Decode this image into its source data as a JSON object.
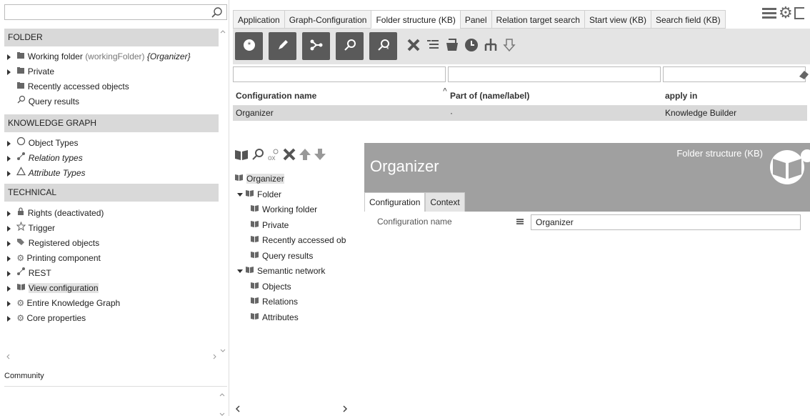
{
  "search": {
    "value": ""
  },
  "sections": {
    "folder": "FOLDER",
    "knowledge_graph": "KNOWLEDGE GRAPH",
    "technical": "TECHNICAL"
  },
  "folder_items": [
    {
      "label": "Working folder",
      "note": "(workingFolder)",
      "extra": "{Organizer}"
    },
    {
      "label": "Private"
    },
    {
      "label": "Recently accessed objects"
    },
    {
      "label": "Query results"
    }
  ],
  "kg_items": [
    {
      "label": "Object Types"
    },
    {
      "label": "Relation types"
    },
    {
      "label": "Attribute Types"
    }
  ],
  "tech_items": [
    {
      "label": "Rights (deactivated)"
    },
    {
      "label": "Trigger"
    },
    {
      "label": "Registered objects"
    },
    {
      "label": "Printing component"
    },
    {
      "label": "REST"
    },
    {
      "label": "View configuration"
    },
    {
      "label": "Entire Knowledge Graph"
    },
    {
      "label": "Core properties"
    }
  ],
  "community": {
    "label": "Community"
  },
  "tabs": [
    "Application",
    "Graph-Configuration",
    "Folder structure (KB)",
    "Panel",
    "Relation target search",
    "Start view (KB)",
    "Search field (KB)"
  ],
  "grid": {
    "headers": [
      "Configuration name",
      "Part of (name/label)",
      "apply in"
    ],
    "row": [
      "Organizer",
      "·",
      "Knowledge Builder"
    ]
  },
  "config_tree": [
    {
      "label": "Organizer",
      "level": 0
    },
    {
      "label": "Folder",
      "level": 0
    },
    {
      "label": "Working folder",
      "level": 1
    },
    {
      "label": "Private",
      "level": 1
    },
    {
      "label": "Recently accessed ob",
      "level": 1
    },
    {
      "label": "Query results",
      "level": 1
    },
    {
      "label": "Semantic network",
      "level": 0
    },
    {
      "label": "Objects",
      "level": 1
    },
    {
      "label": "Relations",
      "level": 1
    },
    {
      "label": "Attributes",
      "level": 1
    }
  ],
  "detail": {
    "title": "Organizer",
    "kind": "Folder structure (KB)",
    "tabs": [
      "Configuration",
      "Context"
    ],
    "field_label": "Configuration name",
    "field_value": "Organizer"
  },
  "colors": {
    "section_bg": "#d9d9d9",
    "toolbar_button": "#5a5a5a",
    "header_bg": "#a0a0a0"
  }
}
